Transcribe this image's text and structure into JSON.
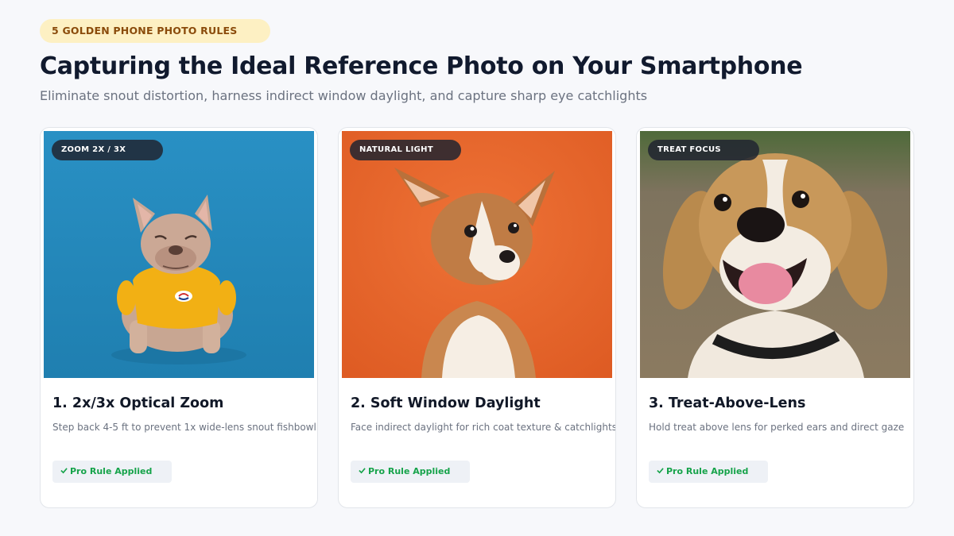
{
  "header": {
    "eyebrow": "5 GOLDEN PHONE PHOTO RULES",
    "title": "Capturing the Ideal Reference Photo on Your Smartphone",
    "subtitle": "Eliminate snout distortion, harness indirect window daylight, and capture sharp eye catchlights"
  },
  "cards": [
    {
      "tag": "ZOOM 2X / 3X",
      "title": "1. 2x/3x Optical Zoom",
      "description": "Step back 4-5 ft to prevent 1x wide-lens snout fishbowl",
      "badge_icon": "check-icon",
      "badge": "Pro Rule Applied",
      "image": "french-bulldog-in-yellow-sweater-on-blue-backdrop"
    },
    {
      "tag": "NATURAL LIGHT",
      "title": "2. Soft Window Daylight",
      "description": "Face indirect daylight for rich coat texture & catchlights",
      "badge_icon": "check-icon",
      "badge": "Pro Rule Applied",
      "image": "corgi-puppy-on-orange-backdrop"
    },
    {
      "tag": "TREAT FOCUS",
      "title": "3. Treat-Above-Lens",
      "description": "Hold treat above lens for perked ears and direct gaze",
      "badge_icon": "check-icon",
      "badge": "Pro Rule Applied",
      "image": "smiling-beagle-outdoors"
    }
  ],
  "colors": {
    "page_background": "#f7f8fb",
    "eyebrow_background": "#fdf0c3",
    "eyebrow_text": "#8a4b0b",
    "badge_text": "#16a34a",
    "photo1_background": "#2a8ec0",
    "photo2_background": "#e7652c",
    "photo3_background": "#7a6c56"
  }
}
